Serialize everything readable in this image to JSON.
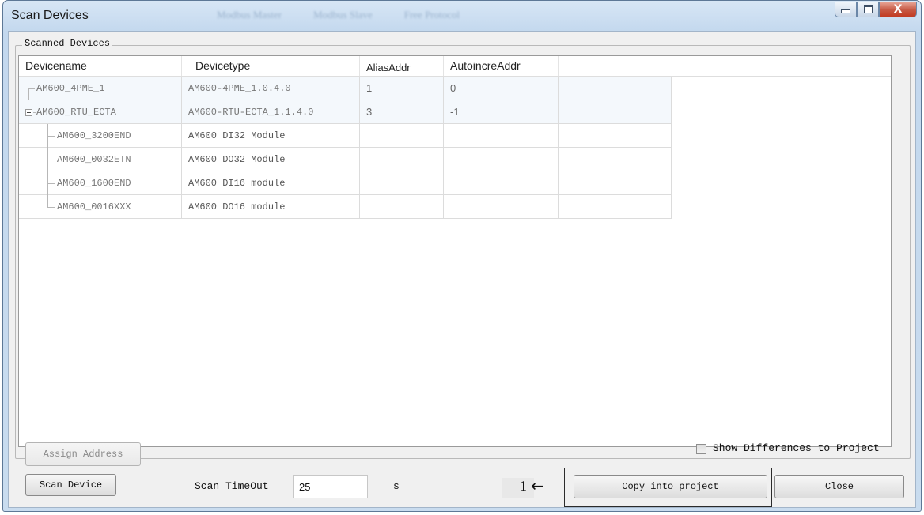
{
  "window": {
    "title": "Scan Devices",
    "ghost_tabs": [
      "Modbus Master",
      "Modbus Slave",
      "Free Protocol"
    ],
    "caption_icons": [
      "minimize-icon",
      "maximize-icon",
      "close-icon"
    ],
    "close_glyph": "X"
  },
  "group": {
    "title": "Scanned Devices"
  },
  "table": {
    "columns": [
      "Devicename",
      "Devicetype",
      "AliasAddr",
      "AutoincreAddr"
    ],
    "rows": [
      {
        "name": "AM600_4PME_1",
        "type": "AM600-4PME_1.0.4.0",
        "alias": "1",
        "autoincr": "0",
        "level": 0
      },
      {
        "name": "AM600_RTU_ECTA",
        "type": "AM600-RTU-ECTA_1.1.4.0",
        "alias": "3",
        "autoincr": "-1",
        "level": 0,
        "expanded": true
      },
      {
        "name": "AM600_3200END",
        "type": "AM600 DI32 Module",
        "alias": "",
        "autoincr": "",
        "level": 1
      },
      {
        "name": "AM600_0032ETN",
        "type": "AM600 DO32 Module",
        "alias": "",
        "autoincr": "",
        "level": 1
      },
      {
        "name": "AM600_1600END",
        "type": "AM600 DI16 module",
        "alias": "",
        "autoincr": "",
        "level": 1
      },
      {
        "name": "AM600_0016XXX",
        "type": "AM600 DO16 module",
        "alias": "",
        "autoincr": "",
        "level": 1
      }
    ]
  },
  "buttons": {
    "assign_address": "Assign Address",
    "scan_device": "Scan Device",
    "copy_into_project": "Copy into project",
    "close": "Close"
  },
  "show_differences": {
    "label": "Show Differences to Project",
    "checked": false
  },
  "scan_timeout": {
    "label": "Scan TimeOut",
    "value": "25",
    "unit": "s"
  },
  "annotation": {
    "number": "1",
    "arrow": "←"
  },
  "colors": {
    "titlebar": "#c3d8ee",
    "close_button": "#c75a45",
    "dialog_bg": "#f0f0f0"
  }
}
